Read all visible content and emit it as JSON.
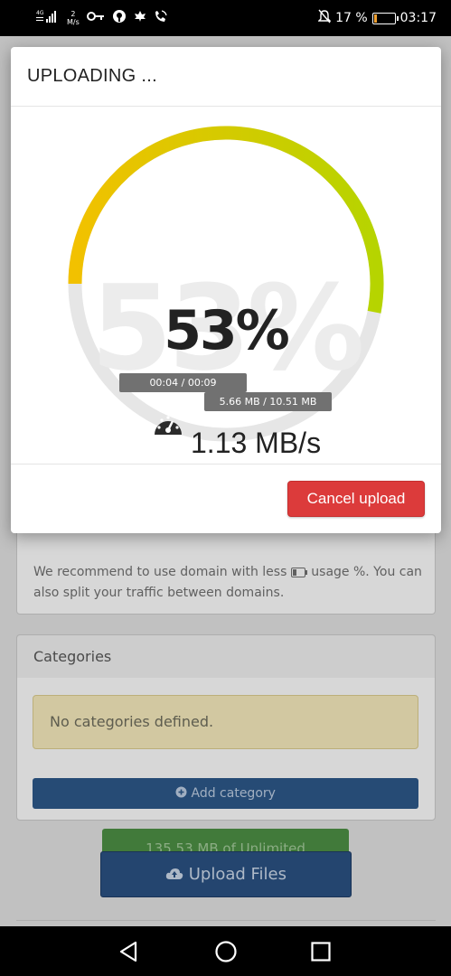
{
  "status_bar": {
    "network_type": "4G",
    "net_speed_value": "2",
    "net_speed_unit": "M/s",
    "battery_percent_text": "17 %",
    "battery_level_percent": 17,
    "time": "03:17",
    "icons": [
      "signal-icon",
      "key-icon",
      "vpn-icon",
      "leaf-icon",
      "wifi-calling-icon",
      "mute-notifications-icon",
      "battery-icon"
    ]
  },
  "background_page": {
    "recommendation_text": "We recommend to use domain with less",
    "recommendation_text_2": "usage %. You can also split your traffic between domains.",
    "categories": {
      "title": "Categories",
      "empty_message": "No categories defined.",
      "add_button": "Add category"
    },
    "quota_text": "135.53 MB of Unlimited",
    "upload_button": "Upload Files"
  },
  "modal": {
    "title": "UPLOADING ...",
    "progress_text": "53%",
    "progress_fraction": 0.53,
    "elapsed_text": "00:04 / 00:09",
    "size_text": "5.66 MB / 10.51 MB",
    "speed_text": "1.13 MB/s",
    "cancel_button": "Cancel upload",
    "colors": {
      "gauge_start": "#f2c100",
      "gauge_end": "#b6d400",
      "gauge_track": "#e6e6e6",
      "cancel": "#dc3b3b"
    }
  },
  "nav_bar": {
    "buttons": [
      "back-icon",
      "home-icon",
      "recents-icon"
    ]
  }
}
